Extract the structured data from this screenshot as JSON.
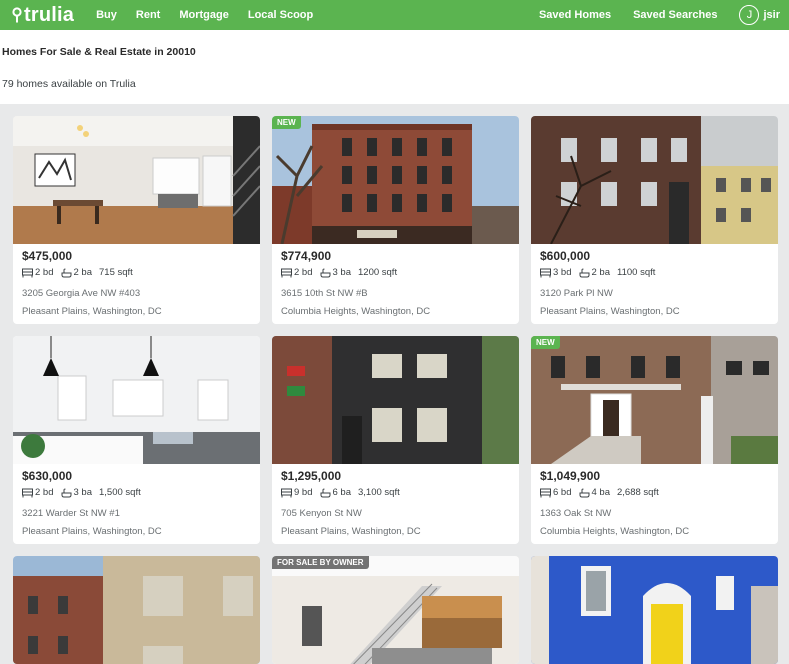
{
  "header": {
    "logo": "trulia",
    "nav": [
      "Buy",
      "Rent",
      "Mortgage",
      "Local Scoop"
    ],
    "saved_homes": "Saved Homes",
    "saved_searches": "Saved Searches",
    "avatar_initial": "J",
    "username": "jsir"
  },
  "page": {
    "heading": "Homes For Sale & Real Estate in 20010",
    "count": "79 homes available on Trulia"
  },
  "listings": [
    {
      "price": "$475,000",
      "beds": "2 bd",
      "baths": "2 ba",
      "sqft": "715 sqft",
      "address": "3205 Georgia Ave NW #403",
      "neighborhood": "Pleasant Plains, Washington, DC",
      "badge": ""
    },
    {
      "price": "$774,900",
      "beds": "2 bd",
      "baths": "3 ba",
      "sqft": "1200 sqft",
      "address": "3615 10th St NW #B",
      "neighborhood": "Columbia Heights, Washington, DC",
      "badge": "NEW"
    },
    {
      "price": "$600,000",
      "beds": "3 bd",
      "baths": "2 ba",
      "sqft": "1100 sqft",
      "address": "3120 Park Pl NW",
      "neighborhood": "Pleasant Plains, Washington, DC",
      "badge": ""
    },
    {
      "price": "$630,000",
      "beds": "2 bd",
      "baths": "3 ba",
      "sqft": "1,500 sqft",
      "address": "3221 Warder St NW #1",
      "neighborhood": "Pleasant Plains, Washington, DC",
      "badge": ""
    },
    {
      "price": "$1,295,000",
      "beds": "9 bd",
      "baths": "6 ba",
      "sqft": "3,100 sqft",
      "address": "705 Kenyon St NW",
      "neighborhood": "Pleasant Plains, Washington, DC",
      "badge": ""
    },
    {
      "price": "$1,049,900",
      "beds": "6 bd",
      "baths": "4 ba",
      "sqft": "2,688 sqft",
      "address": "1363 Oak St NW",
      "neighborhood": "Columbia Heights, Washington, DC",
      "badge": "NEW"
    },
    {
      "badge": ""
    },
    {
      "badge": "FOR SALE BY OWNER"
    },
    {
      "badge": ""
    }
  ]
}
